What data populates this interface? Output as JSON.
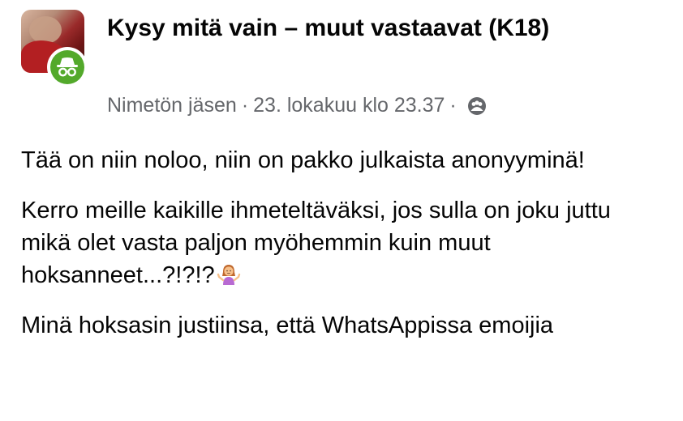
{
  "post": {
    "group_name": "Kysy mitä vain – muut vastaavat (K18)",
    "author": "Nimetön jäsen",
    "separator": "·",
    "timestamp": "23. lokakuu klo 23.37",
    "audience_icon": "group-members-icon",
    "paragraphs": [
      "Tää on niin noloo, niin on pakko julkaista anonyyminä!",
      "Kerro meille kaikille ihmeteltäväksi, jos sulla on joku juttu mikä olet vasta paljon myöhemmin kuin muut hoksanneet...?!?!?",
      "Minä hoksasin justiinsa, että WhatsAppissa  emoijia"
    ],
    "paragraph_emoji": "woman-shrugging-emoji"
  },
  "colors": {
    "anon_badge": "#53a92b",
    "meta_text": "#65676b",
    "text": "#050505"
  }
}
